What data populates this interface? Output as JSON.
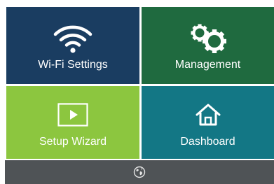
{
  "tiles": [
    {
      "label": "Wi-Fi Settings",
      "icon": "wifi-icon",
      "color": "#1a3d61"
    },
    {
      "label": "Management",
      "icon": "gears-icon",
      "color": "#1f6a3f"
    },
    {
      "label": "Setup Wizard",
      "icon": "play-icon",
      "color": "#8cc63f"
    },
    {
      "label": "Dashboard",
      "icon": "home-icon",
      "color": "#137785"
    }
  ],
  "bottom_bar": {
    "icon": "globe-icon",
    "color": "#4f5356"
  }
}
